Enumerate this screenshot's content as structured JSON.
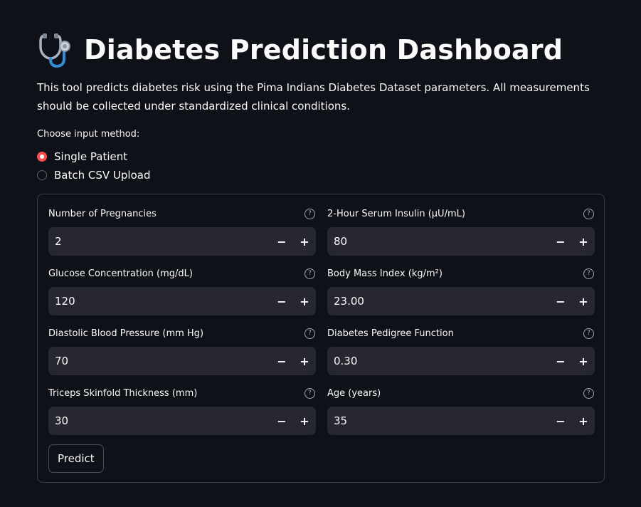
{
  "header": {
    "title": "Diabetes Prediction Dashboard",
    "icon": "stethoscope-icon"
  },
  "description": "This tool predicts diabetes risk using the Pima Indians Diabetes Dataset parameters. All measurements should be collected under standardized clinical conditions.",
  "input_method": {
    "label": "Choose input method:",
    "options": [
      {
        "label": "Single Patient",
        "selected": true
      },
      {
        "label": "Batch CSV Upload",
        "selected": false
      }
    ]
  },
  "form": {
    "fields": [
      {
        "label": "Number of Pregnancies",
        "value": "2"
      },
      {
        "label": "2-Hour Serum Insulin (µU/mL)",
        "value": "80"
      },
      {
        "label": "Glucose Concentration (mg/dL)",
        "value": "120"
      },
      {
        "label": "Body Mass Index (kg/m²)",
        "value": "23.00"
      },
      {
        "label": "Diastolic Blood Pressure (mm Hg)",
        "value": "70"
      },
      {
        "label": "Diabetes Pedigree Function",
        "value": "0.30"
      },
      {
        "label": "Triceps Skinfold Thickness (mm)",
        "value": "30"
      },
      {
        "label": "Age (years)",
        "value": "35"
      }
    ],
    "help_glyph": "?",
    "decrement_glyph": "−",
    "increment_glyph": "+",
    "submit_label": "Predict"
  },
  "colors": {
    "background": "#0e1117",
    "input_background": "#262730",
    "accent": "#ff4b4b",
    "border": "#3a3d45",
    "text": "#fafafa"
  }
}
